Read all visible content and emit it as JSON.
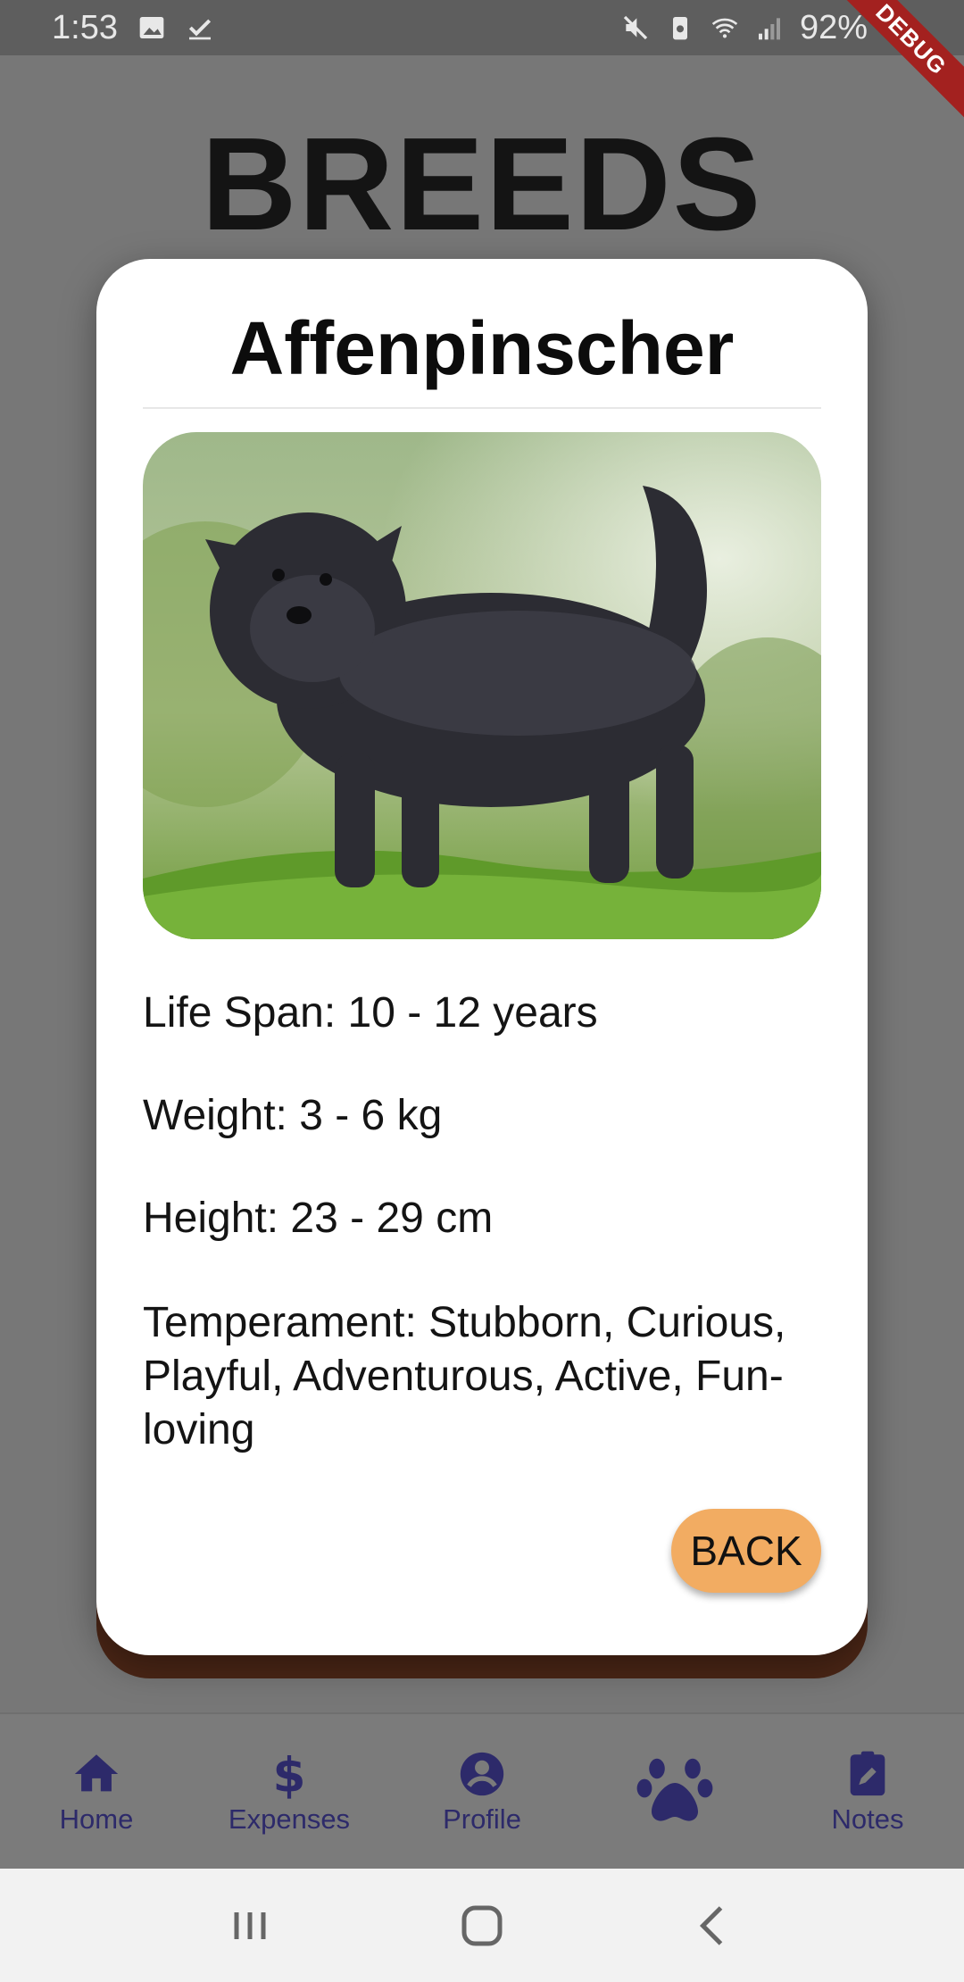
{
  "status_bar": {
    "time": "1:53",
    "battery": "92%",
    "debug_label": "DEBUG"
  },
  "page": {
    "title": "BREEDS"
  },
  "dialog": {
    "breed_name": "Affenpinscher",
    "life_span": "Life Span: 10 - 12 years",
    "weight": "Weight: 3 - 6 kg",
    "height": "Height: 23 - 29 cm",
    "temperament": "Temperament: Stubborn, Curious, Playful, Adventurous, Active, Fun-loving",
    "back_label": "BACK"
  },
  "bottom_nav": {
    "items": [
      {
        "label": "Home",
        "icon": "home-icon"
      },
      {
        "label": "Expenses",
        "icon": "dollar-icon"
      },
      {
        "label": "Profile",
        "icon": "account-icon"
      },
      {
        "label": "",
        "icon": "paw-icon",
        "active": true
      },
      {
        "label": "Notes",
        "icon": "note-edit-icon"
      }
    ]
  },
  "colors": {
    "nav_accent": "#2d2a6a",
    "back_button": "#f2ac62",
    "dialog_shadow": "#4b2616",
    "debug_ribbon": "#a3211f"
  }
}
